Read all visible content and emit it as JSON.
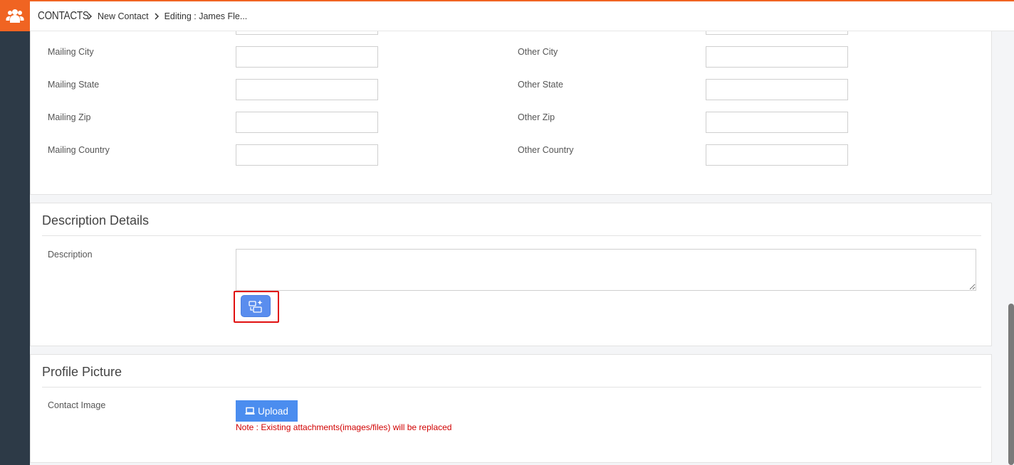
{
  "app": {
    "module_icon": "users-group-icon",
    "accent_color": "#f06422"
  },
  "breadcrumb": {
    "module": "CONTACTS",
    "items": [
      "New Contact",
      "Editing : James Fle..."
    ]
  },
  "address": {
    "left": [
      {
        "label": "Mailing City",
        "value": ""
      },
      {
        "label": "Mailing State",
        "value": ""
      },
      {
        "label": "Mailing Zip",
        "value": ""
      },
      {
        "label": "Mailing Country",
        "value": ""
      }
    ],
    "right": [
      {
        "label": "Other City",
        "value": ""
      },
      {
        "label": "Other State",
        "value": ""
      },
      {
        "label": "Other Zip",
        "value": ""
      },
      {
        "label": "Other Country",
        "value": ""
      }
    ]
  },
  "description_section": {
    "title": "Description Details",
    "field_label": "Description",
    "value": "",
    "ai_button_icon": "ai-sparkle-icon"
  },
  "profile_section": {
    "title": "Profile Picture",
    "field_label": "Contact Image",
    "upload_label": "Upload",
    "note": "Note : Existing attachments(images/files) will be replaced"
  }
}
